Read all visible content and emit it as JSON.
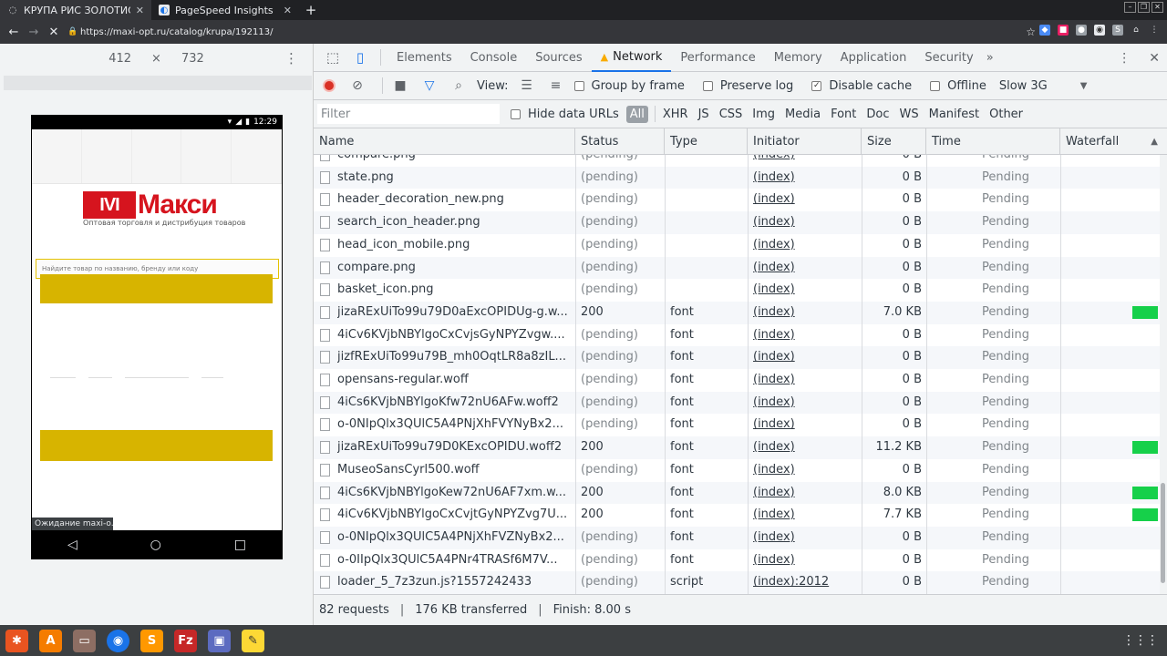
{
  "browser": {
    "tabs": [
      {
        "title": "КРУПА РИС ЗОЛОТИСТЫ",
        "favicon": "loading-icon",
        "active": true
      },
      {
        "title": "PageSpeed Insights",
        "favicon": "pagespeed-icon",
        "active": false
      }
    ],
    "url": "https://maxi-opt.ru/catalog/krupa/192113/"
  },
  "device": {
    "width": "412",
    "times": "×",
    "height": "732",
    "status_time": "12:29",
    "site": {
      "logo_mark": "IVI",
      "logo_text": "Макси",
      "tagline": "Оптовая торговля и дистрибуция товаров",
      "search_placeholder": "Найдите товар по названию, бренду или коду"
    },
    "status_tooltip": "Ожидание maxi-o..."
  },
  "devtools": {
    "tabs": [
      "Elements",
      "Console",
      "Sources",
      "Network",
      "Performance",
      "Memory",
      "Application",
      "Security"
    ],
    "more": "»",
    "toolbar": {
      "view_label": "View:",
      "group_by_frame": "Group by frame",
      "preserve_log": "Preserve log",
      "disable_cache": "Disable cache",
      "offline": "Offline",
      "throttling": "Slow 3G"
    },
    "filter": {
      "placeholder": "Filter",
      "hide_data_urls": "Hide data URLs",
      "types": [
        "All",
        "XHR",
        "JS",
        "CSS",
        "Img",
        "Media",
        "Font",
        "Doc",
        "WS",
        "Manifest",
        "Other"
      ]
    },
    "columns": [
      "Name",
      "Status",
      "Type",
      "Initiator",
      "Size",
      "Time",
      "Waterfall"
    ],
    "rows": [
      {
        "name": "compare.png",
        "status": "(pending)",
        "type": "",
        "initiator": "(index)",
        "size": "0 B",
        "time": "Pending",
        "wf": 0
      },
      {
        "name": "state.png",
        "status": "(pending)",
        "type": "",
        "initiator": "(index)",
        "size": "0 B",
        "time": "Pending",
        "wf": 0
      },
      {
        "name": "header_decoration_new.png",
        "status": "(pending)",
        "type": "",
        "initiator": "(index)",
        "size": "0 B",
        "time": "Pending",
        "wf": 0
      },
      {
        "name": "search_icon_header.png",
        "status": "(pending)",
        "type": "",
        "initiator": "(index)",
        "size": "0 B",
        "time": "Pending",
        "wf": 0
      },
      {
        "name": "head_icon_mobile.png",
        "status": "(pending)",
        "type": "",
        "initiator": "(index)",
        "size": "0 B",
        "time": "Pending",
        "wf": 0
      },
      {
        "name": "compare.png",
        "status": "(pending)",
        "type": "",
        "initiator": "(index)",
        "size": "0 B",
        "time": "Pending",
        "wf": 0
      },
      {
        "name": "basket_icon.png",
        "status": "(pending)",
        "type": "",
        "initiator": "(index)",
        "size": "0 B",
        "time": "Pending",
        "wf": 0
      },
      {
        "name": "jizaRExUiTo99u79D0aExcOPIDUg-g.w...",
        "status": "200",
        "type": "font",
        "initiator": "(index)",
        "size": "7.0 KB",
        "time": "Pending",
        "wf": 1
      },
      {
        "name": "4iCv6KVjbNBYlgoCxCvjsGyNPYZvgw....",
        "status": "(pending)",
        "type": "font",
        "initiator": "(index)",
        "size": "0 B",
        "time": "Pending",
        "wf": 0
      },
      {
        "name": "jizfRExUiTo99u79B_mh0OqtLR8a8zIL...",
        "status": "(pending)",
        "type": "font",
        "initiator": "(index)",
        "size": "0 B",
        "time": "Pending",
        "wf": 0
      },
      {
        "name": "opensans-regular.woff",
        "status": "(pending)",
        "type": "font",
        "initiator": "(index)",
        "size": "0 B",
        "time": "Pending",
        "wf": 0
      },
      {
        "name": "4iCs6KVjbNBYlgoKfw72nU6AFw.woff2",
        "status": "(pending)",
        "type": "font",
        "initiator": "(index)",
        "size": "0 B",
        "time": "Pending",
        "wf": 0
      },
      {
        "name": "o-0NIpQlx3QUlC5A4PNjXhFVYNyBx2...",
        "status": "(pending)",
        "type": "font",
        "initiator": "(index)",
        "size": "0 B",
        "time": "Pending",
        "wf": 0
      },
      {
        "name": "jizaRExUiTo99u79D0KExcOPIDU.woff2",
        "status": "200",
        "type": "font",
        "initiator": "(index)",
        "size": "11.2 KB",
        "time": "Pending",
        "wf": 1
      },
      {
        "name": "MuseoSansCyrl500.woff",
        "status": "(pending)",
        "type": "font",
        "initiator": "(index)",
        "size": "0 B",
        "time": "Pending",
        "wf": 0
      },
      {
        "name": "4iCs6KVjbNBYlgoKew72nU6AF7xm.w...",
        "status": "200",
        "type": "font",
        "initiator": "(index)",
        "size": "8.0 KB",
        "time": "Pending",
        "wf": 1
      },
      {
        "name": "4iCv6KVjbNBYlgoCxCvjtGyNPYZvg7U...",
        "status": "200",
        "type": "font",
        "initiator": "(index)",
        "size": "7.7 KB",
        "time": "Pending",
        "wf": 1
      },
      {
        "name": "o-0NIpQlx3QUlC5A4PNjXhFVZNyBx2...",
        "status": "(pending)",
        "type": "font",
        "initiator": "(index)",
        "size": "0 B",
        "time": "Pending",
        "wf": 0
      },
      {
        "name": "o-0IIpQlx3QUlC5A4PNr4TRASf6M7V...",
        "status": "(pending)",
        "type": "font",
        "initiator": "(index)",
        "size": "0 B",
        "time": "Pending",
        "wf": 0
      },
      {
        "name": "loader_5_7z3zun.js?1557242433",
        "status": "(pending)",
        "type": "script",
        "initiator": "(index):2012",
        "size": "0 B",
        "time": "Pending",
        "wf": 0
      }
    ],
    "summary": {
      "requests": "82 requests",
      "transferred": "176 KB transferred",
      "finish": "Finish: 8.00 s"
    }
  },
  "colors": {
    "accent": "#1a73e8",
    "record": "#d93025",
    "waterfall": "#16d04a",
    "site_red": "#d6141e",
    "site_yellow": "#d7b400"
  }
}
